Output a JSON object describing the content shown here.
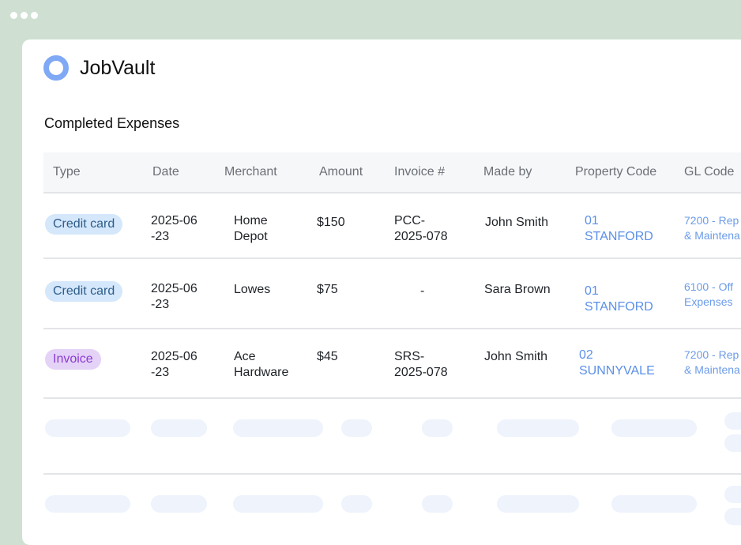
{
  "app": {
    "name": "JobVault"
  },
  "section": {
    "title": "Completed Expenses"
  },
  "colors": {
    "background": "#cfe0d3",
    "accent": "#7fa8f5",
    "link": "#5b8fe8",
    "credit_badge": "#d4e7fb",
    "invoice_badge": "#e4d2f7"
  },
  "table": {
    "columns": [
      "Type",
      "Date",
      "Merchant",
      "Amount",
      "Invoice #",
      "Made by",
      "Property Code",
      "GL Code"
    ],
    "rows": [
      {
        "type": "Credit card",
        "date": "2025-06\n-23",
        "merchant": "Home\nDepot",
        "amount": "$150",
        "invoice": "PCC-\n2025-078",
        "made_by": "John Smith",
        "property": "01\nSTANFORD",
        "gl": "7200 - Rep\n& Maintena"
      },
      {
        "type": "Credit card",
        "date": "2025-06\n-23",
        "merchant": "Lowes",
        "amount": "$75",
        "invoice": "-",
        "made_by": "Sara Brown",
        "property": "01\nSTANFORD",
        "gl": "6100 - Off\nExpenses"
      },
      {
        "type": "Invoice",
        "date": "2025-06\n-23",
        "merchant": "Ace\nHardware",
        "amount": "$45",
        "invoice": "SRS-\n2025-078",
        "made_by": "John Smith",
        "property": "02\nSUNNYVALE",
        "gl": "7200 - Rep\n& Maintena"
      }
    ]
  }
}
